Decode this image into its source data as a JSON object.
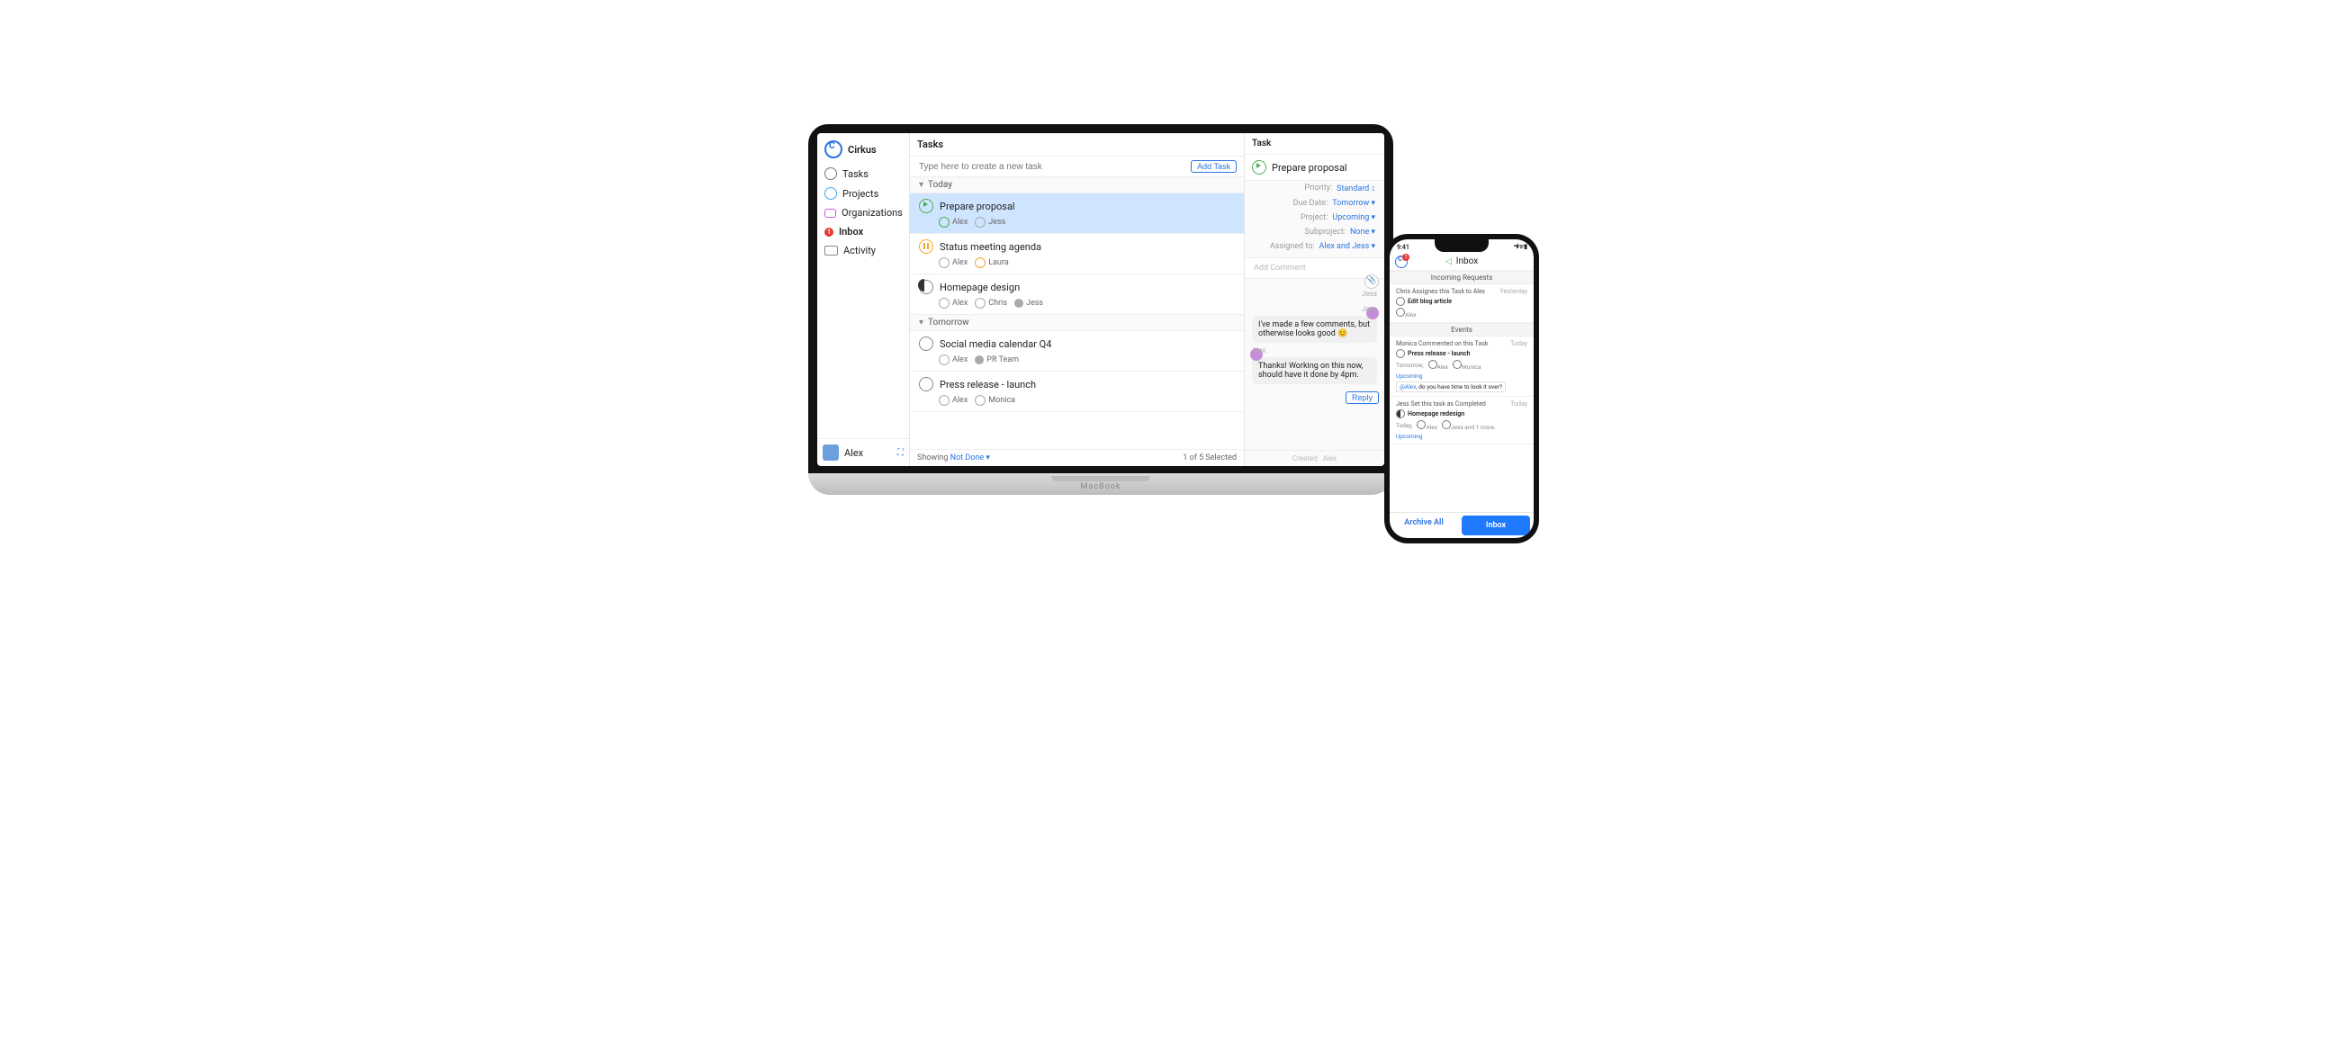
{
  "laptop": {
    "app_name": "Cirkus",
    "device_brand": "MacBook",
    "nav": {
      "items": [
        {
          "label": "Tasks",
          "id": "tasks"
        },
        {
          "label": "Projects",
          "id": "projects"
        },
        {
          "label": "Organizations",
          "id": "organizations"
        },
        {
          "label": "Inbox",
          "id": "inbox",
          "badge": "1"
        },
        {
          "label": "Activity",
          "id": "activity"
        }
      ]
    },
    "current_user": "Alex",
    "tasks_header": "Tasks",
    "new_task_placeholder": "Type here to create a new task",
    "add_task_btn": "Add Task",
    "groups": [
      {
        "label": "Today",
        "tasks": [
          {
            "title": "Prepare proposal",
            "status": "play",
            "selected": true,
            "assignees": [
              {
                "name": "Alex",
                "ic": "play"
              },
              {
                "name": "Jess",
                "ic": "open"
              }
            ]
          },
          {
            "title": "Status meeting agenda",
            "status": "pause",
            "assignees": [
              {
                "name": "Alex",
                "ic": "open"
              },
              {
                "name": "Laura",
                "ic": "pause"
              }
            ]
          },
          {
            "title": "Homepage design",
            "status": "half",
            "assignees": [
              {
                "name": "Alex",
                "ic": "open"
              },
              {
                "name": "Chris",
                "ic": "open"
              },
              {
                "name": "Jess",
                "ic": "fill"
              }
            ]
          }
        ]
      },
      {
        "label": "Tomorrow",
        "tasks": [
          {
            "title": "Social media calendar Q4",
            "status": "open",
            "assignees": [
              {
                "name": "Alex",
                "ic": "open"
              },
              {
                "name": "PR Team",
                "ic": "fill"
              }
            ]
          },
          {
            "title": "Press release - launch",
            "status": "open",
            "assignees": [
              {
                "name": "Alex",
                "ic": "open"
              },
              {
                "name": "Monica",
                "ic": "open"
              }
            ]
          }
        ]
      }
    ],
    "footer": {
      "showing_prefix": "Showing",
      "showing_filter": "Not Done",
      "selection_text": "1 of 5 Selected"
    },
    "detail": {
      "header": "Task",
      "title": "Prepare proposal",
      "status": "play",
      "fields": [
        {
          "k": "Priority:",
          "v": "Standard",
          "suffix": "↕"
        },
        {
          "k": "Due Date:",
          "v": "Tomorrow",
          "suffix": "▾"
        },
        {
          "k": "Project:",
          "v": "Upcoming",
          "suffix": "▾"
        },
        {
          "k": "Subproject:",
          "v": "None",
          "suffix": "▾"
        },
        {
          "k": "Assigned to:",
          "v": "Alex and Jess",
          "suffix": "▾"
        }
      ],
      "add_comment_placeholder": "Add Comment",
      "thread_side_label": "Jess",
      "messages": [
        {
          "author": "Jess",
          "side": "right",
          "text": "I've made a few comments, but otherwise looks good 😊"
        },
        {
          "author": "Alex",
          "side": "left",
          "text": "Thanks! Working on this now, should have it done by 4pm."
        }
      ],
      "reply_btn": "Reply",
      "created_label": "Created",
      "created_by": "Alex"
    }
  },
  "phone": {
    "time": "9:41",
    "title": "Inbox",
    "logo_badge": "3",
    "sections": [
      {
        "label": "Incoming Requests",
        "items": [
          {
            "headline": "Chris Assignes this Task to Alex",
            "when": "Yesterday",
            "task_title": "Edit blog article",
            "task_ic": "open",
            "meta_people": [
              "Alex"
            ]
          }
        ]
      },
      {
        "label": "Events",
        "items": [
          {
            "headline": "Monica Commented on this Task",
            "when": "Today",
            "task_title": "Press release - launch",
            "task_ic": "open",
            "meta_text": "Tomorrow,",
            "meta_people": [
              "Alex",
              "Monica"
            ],
            "project": "Upcoming",
            "mention_user": "@Alex",
            "mention_text": ", do you have time to look it over?"
          },
          {
            "headline": "Jess Set this task as Completed",
            "when": "Today",
            "task_title": "Homepage redesign",
            "task_ic": "moon",
            "meta_text": "Today,",
            "meta_people": [
              "Alex",
              "Jess and 1 more."
            ],
            "project": "Upcoming"
          }
        ]
      }
    ],
    "tabs": {
      "archive": "Archive All",
      "inbox": "Inbox"
    }
  }
}
